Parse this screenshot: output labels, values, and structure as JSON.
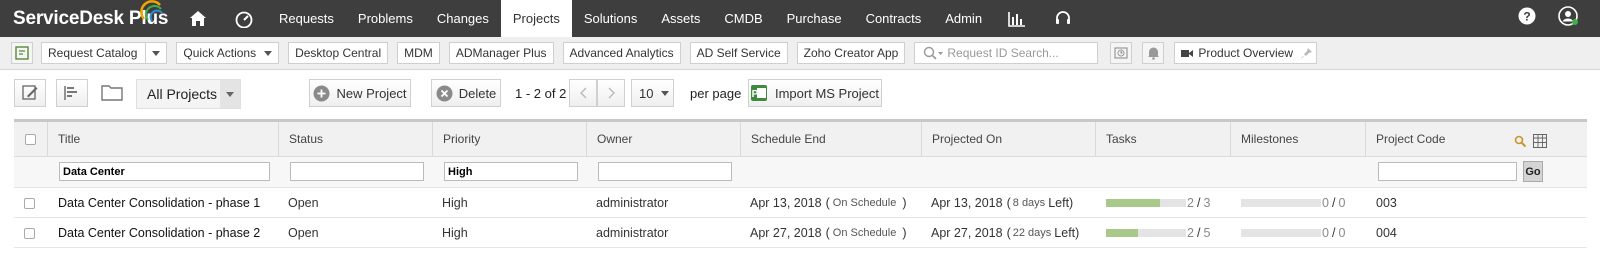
{
  "app": {
    "brand": "ServiceDesk Plus"
  },
  "topnav": {
    "items": [
      "Requests",
      "Problems",
      "Changes",
      "Projects",
      "Solutions",
      "Assets",
      "CMDB",
      "Purchase",
      "Contracts",
      "Admin"
    ],
    "active": "Projects"
  },
  "toolbar": {
    "request_catalog": "Request Catalog",
    "quick_actions": "Quick Actions",
    "links": [
      "Desktop Central",
      "MDM",
      "ADManager Plus",
      "Advanced Analytics",
      "AD Self Service",
      "Zoho Creator App"
    ],
    "search_placeholder": "Request ID Search...",
    "product_overview": "Product Overview"
  },
  "actions": {
    "view_select": "All Projects",
    "new_project": "New Project",
    "delete": "Delete",
    "range": "1 - 2 of 2",
    "page_size": "10",
    "per_page": "per page",
    "import": "Import MS Project"
  },
  "table": {
    "columns": [
      "Title",
      "Status",
      "Priority",
      "Owner",
      "Schedule End",
      "Projected On",
      "Tasks",
      "Milestones",
      "Project Code"
    ],
    "filters": {
      "title": "Data Center",
      "priority": "High",
      "go": "Go"
    },
    "rows": [
      {
        "title": "Data Center Consolidation - phase 1",
        "status": "Open",
        "priority": "High",
        "owner": "administrator",
        "schedule_end": "Apr 13, 2018",
        "schedule_state": "On Schedule",
        "projected_on": "Apr 13, 2018",
        "days_left": "8 days",
        "left_label": "Left",
        "tasks_done": "2",
        "tasks_total": "3",
        "tasks_progress": 0.67,
        "milestones_done": "0",
        "milestones_total": "0",
        "milestones_progress": 0,
        "code": "003"
      },
      {
        "title": "Data Center Consolidation - phase 2",
        "status": "Open",
        "priority": "High",
        "owner": "administrator",
        "schedule_end": "Apr 27, 2018",
        "schedule_state": "On Schedule",
        "projected_on": "Apr 27, 2018",
        "days_left": "22 days",
        "left_label": "Left",
        "tasks_done": "2",
        "tasks_total": "5",
        "tasks_progress": 0.4,
        "milestones_done": "0",
        "milestones_total": "0",
        "milestones_progress": 0,
        "code": "004"
      }
    ]
  },
  "colors": {
    "nav_bg": "#3e3e3e",
    "progress_fill": "#a9c98a",
    "progress_track": "#e4e4e4"
  }
}
